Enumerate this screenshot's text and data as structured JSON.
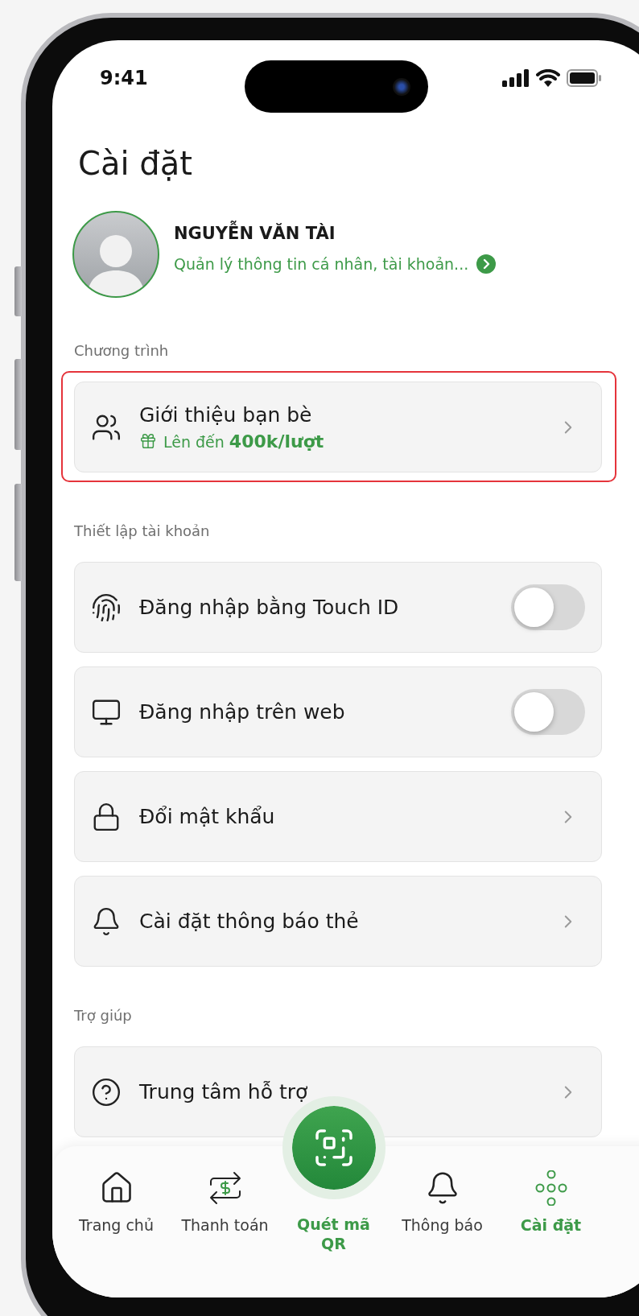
{
  "status_bar": {
    "time": "9:41"
  },
  "title": "Cài đặt",
  "profile": {
    "name": "NGUYỄN VĂN TÀI",
    "subtitle": "Quản lý thông tin cá nhân, tài khoản..."
  },
  "sections": [
    {
      "heading": "Chương trình",
      "items": [
        {
          "kind": "link",
          "label": "Giới thiệu bạn bè",
          "note": "Lên đến **400k/lượt**",
          "highlighted": true
        }
      ]
    },
    {
      "heading": "Thiết lập tài khoản",
      "items": [
        {
          "kind": "toggle",
          "label": "Đăng nhập bằng Touch ID",
          "on": false
        },
        {
          "kind": "toggle",
          "label": "Đăng nhập trên web",
          "on": false
        },
        {
          "kind": "link",
          "label": "Đổi mật khẩu",
          "highlighted": false
        },
        {
          "kind": "link",
          "label": "Cài đặt thông báo thẻ",
          "highlighted": false
        }
      ]
    },
    {
      "heading": "Trợ giúp",
      "items": [
        {
          "kind": "link",
          "label": "Trung tâm hỗ trợ",
          "highlighted": false
        }
      ]
    }
  ],
  "tab_bar": [
    {
      "kind": "tab",
      "label": "Trang chủ",
      "selected": false
    },
    {
      "kind": "tab",
      "label": "Thanh toán",
      "selected": false
    },
    {
      "kind": "scan",
      "label": "Quét mã QR",
      "selected": false
    },
    {
      "kind": "tab",
      "label": "Thông báo",
      "selected": false
    },
    {
      "kind": "tab",
      "label": "Cài đặt",
      "selected": true
    }
  ]
}
